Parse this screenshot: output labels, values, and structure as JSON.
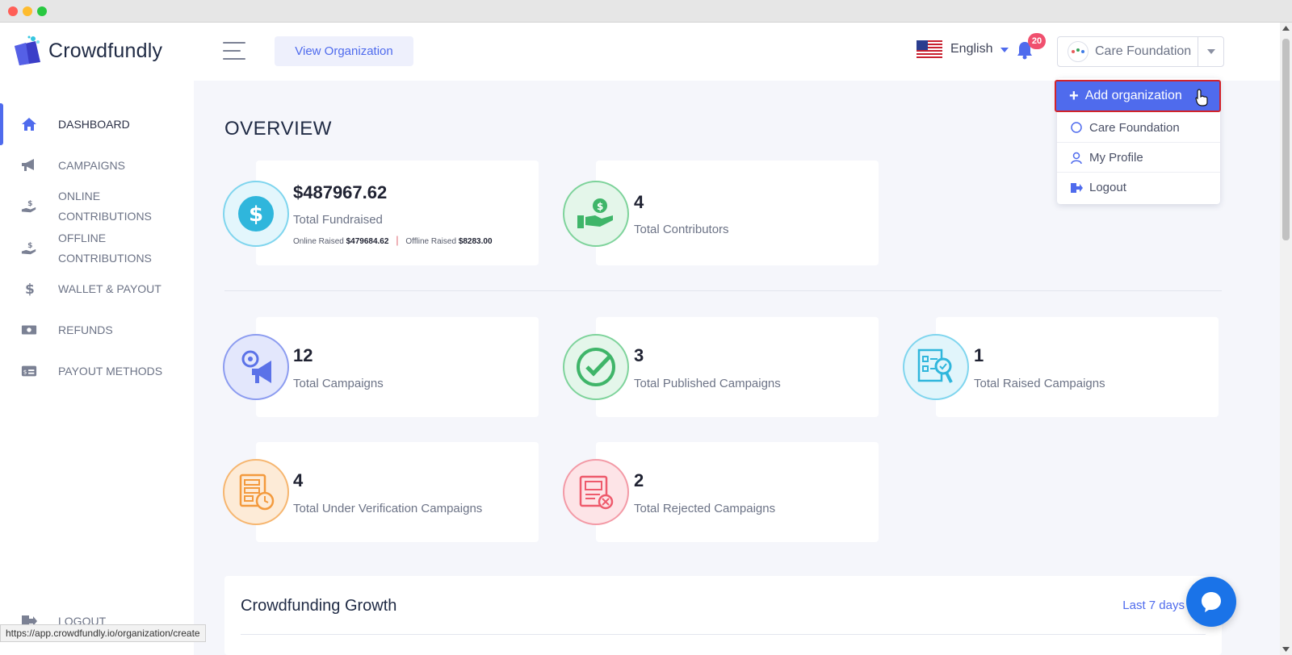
{
  "app": {
    "name": "Crowdfundly"
  },
  "sidebar": {
    "items": [
      {
        "label": "DASHBOARD",
        "icon": "home-icon",
        "active": true
      },
      {
        "label": "CAMPAIGNS",
        "icon": "megaphone-icon"
      },
      {
        "label": "ONLINE CONTRIBUTIONS",
        "icon": "hand-dollar-icon"
      },
      {
        "label": "OFFLINE CONTRIBUTIONS",
        "icon": "hand-dollar-icon"
      },
      {
        "label": "WALLET & PAYOUT",
        "icon": "dollar-icon"
      },
      {
        "label": "REFUNDS",
        "icon": "cash-icon"
      },
      {
        "label": "PAYOUT METHODS",
        "icon": "card-icon"
      },
      {
        "label": "LOGOUT",
        "icon": "logout-icon"
      }
    ]
  },
  "header": {
    "view_org_label": "View Organization",
    "language": "English",
    "notifications_count": "20",
    "org_name": "Care Foundation"
  },
  "dropdown": {
    "add_label": "Add organization",
    "items": [
      {
        "label": "Care Foundation",
        "icon": "circle-icon"
      },
      {
        "label": "My Profile",
        "icon": "user-icon"
      },
      {
        "label": "Logout",
        "icon": "logout-icon"
      }
    ]
  },
  "overview": {
    "title": "OVERVIEW",
    "total_fundraised": {
      "value": "$487967.62",
      "label": "Total Fundraised",
      "online_label": "Online Raised",
      "online_value": "$479684.62",
      "offline_label": "Offline Raised",
      "offline_value": "$8283.00"
    },
    "total_contributors": {
      "value": "4",
      "label": "Total Contributors"
    },
    "campaign_stats": [
      {
        "value": "12",
        "label": "Total Campaigns",
        "color": "#5b72e8"
      },
      {
        "value": "3",
        "label": "Total Published Campaigns",
        "color": "#3fb569"
      },
      {
        "value": "1",
        "label": "Total Raised Campaigns",
        "color": "#2fb6dc"
      },
      {
        "value": "4",
        "label": "Total Under Verification Campaigns",
        "color": "#f39a3d"
      },
      {
        "value": "2",
        "label": "Total Rejected Campaigns",
        "color": "#ee5a6c"
      }
    ]
  },
  "growth": {
    "title": "Crowdfunding Growth",
    "range": "Last 7 days"
  },
  "status_bar": {
    "url": "https://app.crowdfundly.io/organization/create"
  },
  "colors": {
    "accent": "#4f6bed",
    "badge": "#f0506e",
    "highlight_border": "#d2232a"
  }
}
